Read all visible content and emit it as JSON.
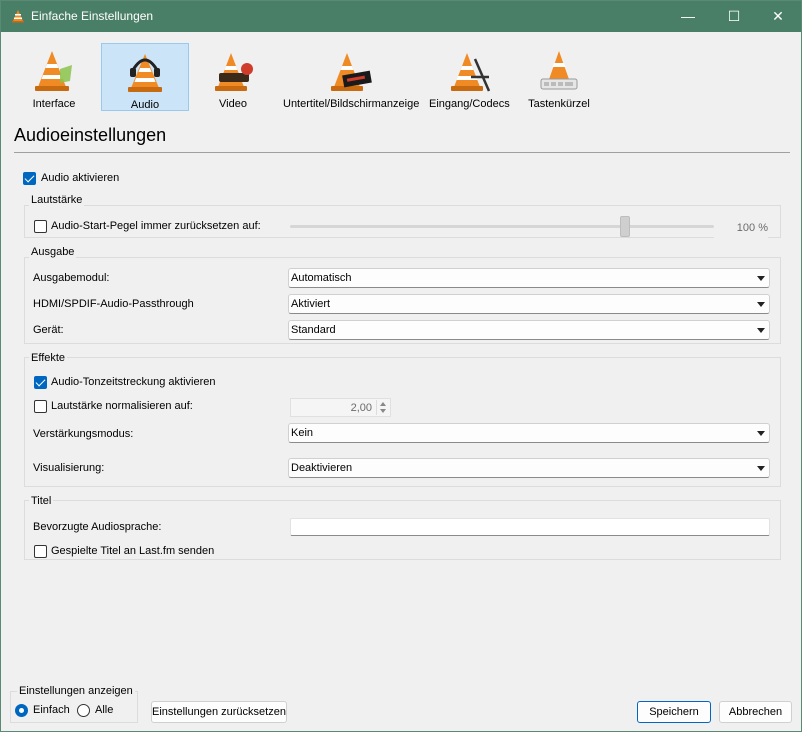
{
  "window": {
    "title": "Einfache Einstellungen",
    "minimize": "—",
    "maximize": "☐",
    "close": "✕"
  },
  "categories": [
    {
      "label": "Interface",
      "icon": "interface-cone-icon"
    },
    {
      "label": "Audio",
      "icon": "audio-headphones-cone-icon",
      "selected": true
    },
    {
      "label": "Video",
      "icon": "video-cone-icon"
    },
    {
      "label": "Untertitel/Bildschirmanzeige",
      "icon": "subtitles-cone-icon"
    },
    {
      "label": "Eingang/Codecs",
      "icon": "codecs-cone-icon"
    },
    {
      "label": "Tastenkürzel",
      "icon": "hotkeys-cone-icon"
    }
  ],
  "page_title": "Audioeinstellungen",
  "audio_enable": {
    "label": "Audio aktivieren",
    "checked": true
  },
  "volume": {
    "group_title": "Lautstärke",
    "reset_label": "Audio-Start-Pegel immer zurücksetzen auf:",
    "reset_checked": false,
    "value_text": "100 %",
    "level": 0.79
  },
  "output": {
    "group_title": "Ausgabe",
    "module_label": "Ausgabemodul:",
    "module_value": "Automatisch",
    "passthrough_label": "HDMI/SPDIF-Audio-Passthrough",
    "passthrough_value": "Aktiviert",
    "device_label": "Gerät:",
    "device_value": "Standard"
  },
  "effects": {
    "group_title": "Effekte",
    "stretch_label": "Audio-Tonzeitstreckung aktivieren",
    "stretch_checked": true,
    "normalize_label": "Lautstärke normalisieren auf:",
    "normalize_checked": false,
    "normalize_value": "2,00",
    "replaygain_label": "Verstärkungsmodus:",
    "replaygain_value": "Kein",
    "visualization_label": "Visualisierung:",
    "visualization_value": "Deaktivieren"
  },
  "tracks": {
    "group_title": "Titel",
    "language_label": "Bevorzugte Audiosprache:",
    "language_value": "",
    "lastfm_label": "Gespielte Titel an Last.fm senden",
    "lastfm_checked": false
  },
  "footer": {
    "show_group_title": "Einstellungen anzeigen",
    "simple_label": "Einfach",
    "all_label": "Alle",
    "selected": "Einfach",
    "reset_button": "Einstellungen zurücksetzen",
    "save_button": "Speichern",
    "cancel_button": "Abbrechen"
  },
  "colors": {
    "titlebar": "#4a7f67",
    "accent": "#0067c0",
    "cone_orange": "#f08a24"
  }
}
